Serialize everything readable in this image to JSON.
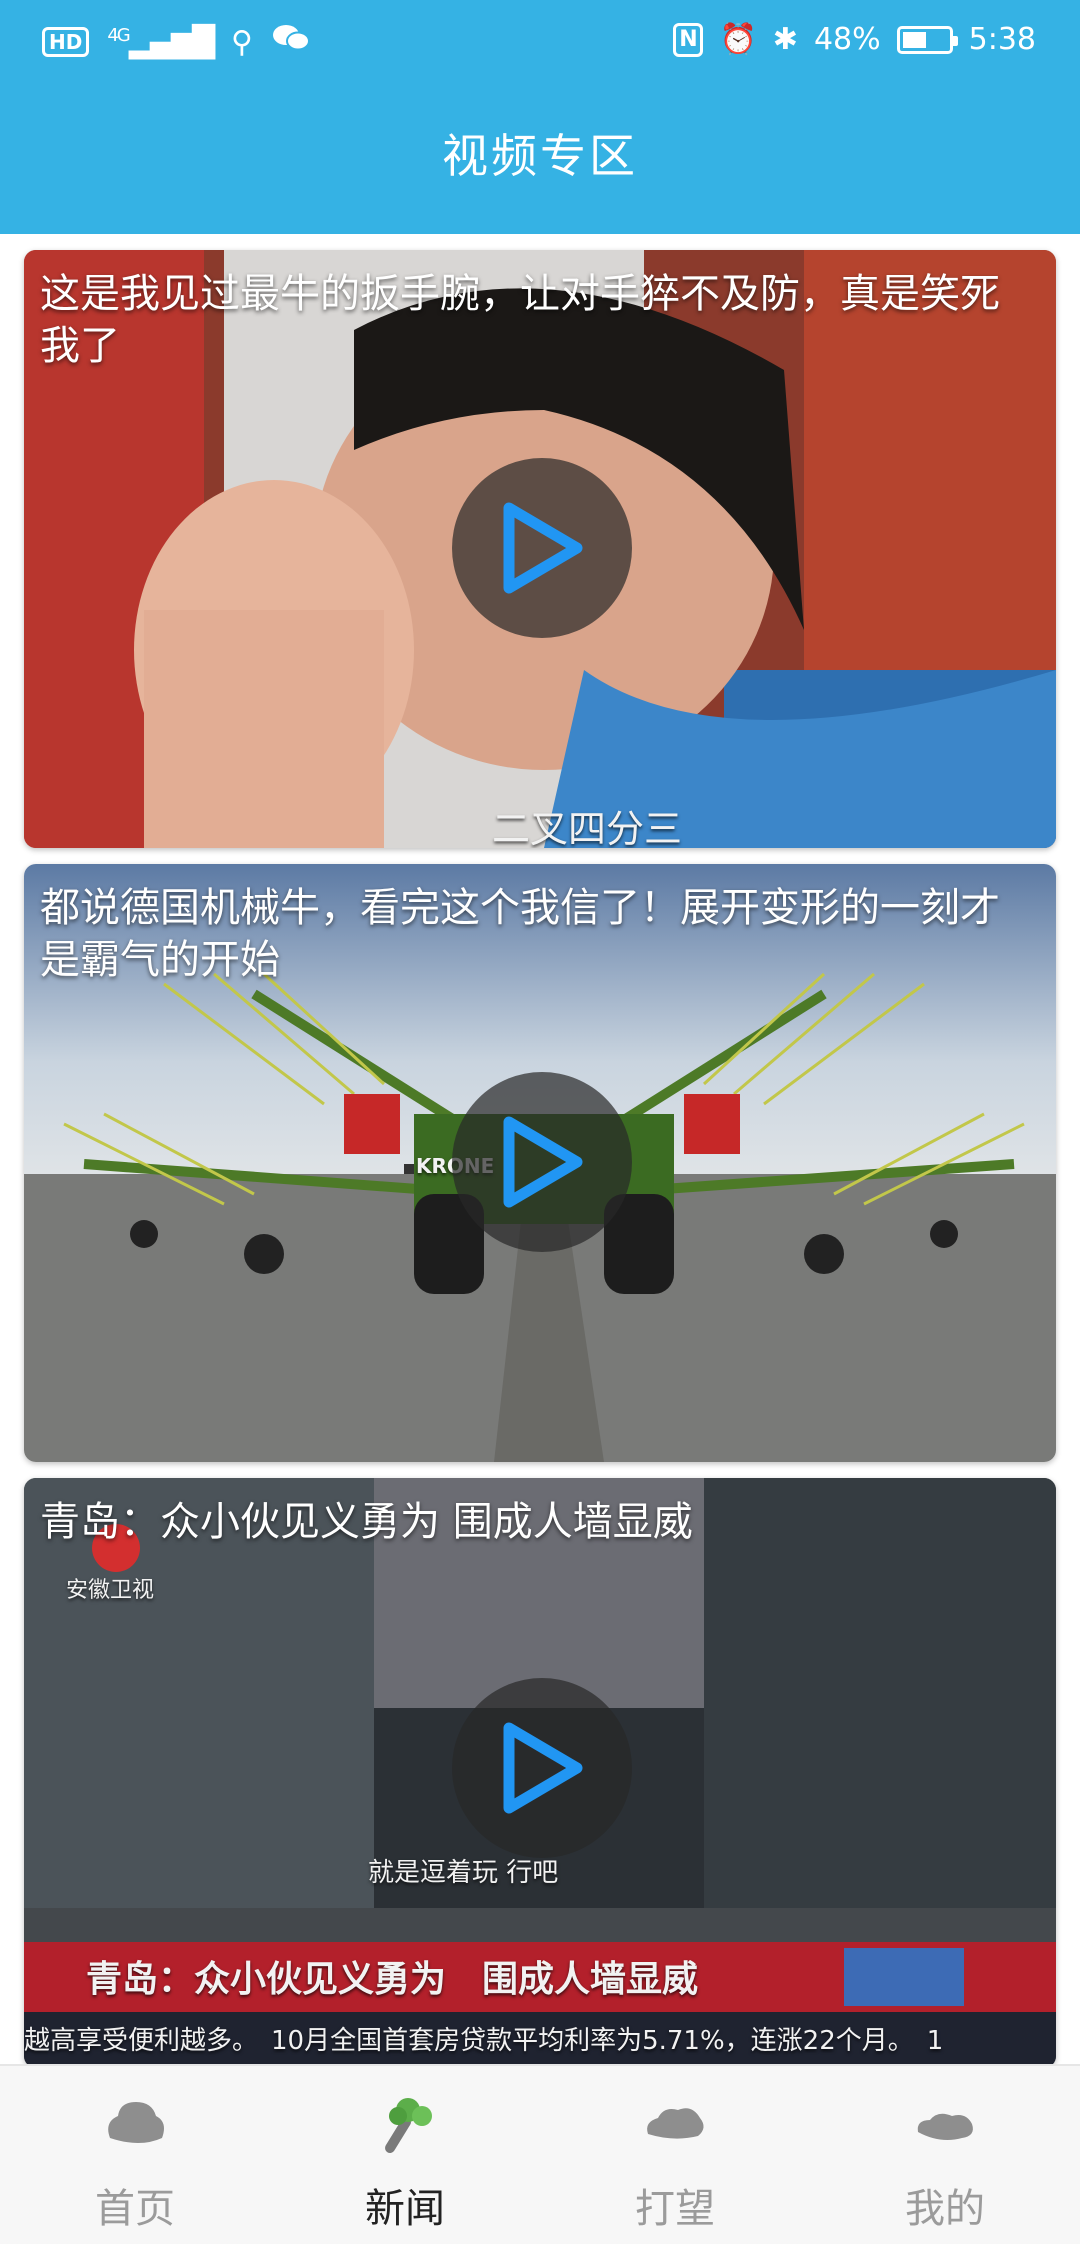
{
  "status_bar": {
    "hd": "HD",
    "network": "4G",
    "battery": "48%",
    "time": "5:38"
  },
  "app_bar": {
    "title": "视频专区"
  },
  "videos": [
    {
      "title": "这是我见过最牛的扳手腕，让对手猝不及防，真是笑死我了",
      "overlay_caption": "二叉四分三"
    },
    {
      "title": "都说德国机械牛，看完这个我信了！展开变形的一刻才是霸气的开始",
      "overlay_caption": "KRONE"
    },
    {
      "title": "青岛：众小伙见义勇为 围成人墙显威",
      "overlay_caption": "就是逗着玩 行吧",
      "channel_logo": "安徽卫视",
      "banner_text": "青岛：众小伙见义勇为　围成人墙显威",
      "ticker_text": "越高享受便利越多。　10月全国首套房贷款平均利率为5.71%，连涨22个月。　1"
    }
  ],
  "bottom_nav": {
    "items": [
      {
        "label": "首页",
        "icon": "home-cloud-icon",
        "active": false
      },
      {
        "label": "新闻",
        "icon": "vegetable-icon",
        "active": true
      },
      {
        "label": "打望",
        "icon": "browse-cloud-icon",
        "active": false
      },
      {
        "label": "我的",
        "icon": "profile-cloud-icon",
        "active": false
      }
    ]
  },
  "colors": {
    "primary": "#35b2e4",
    "play_icon": "#2196f3",
    "nav_active": "#222222",
    "nav_inactive": "#9b9b9b"
  }
}
